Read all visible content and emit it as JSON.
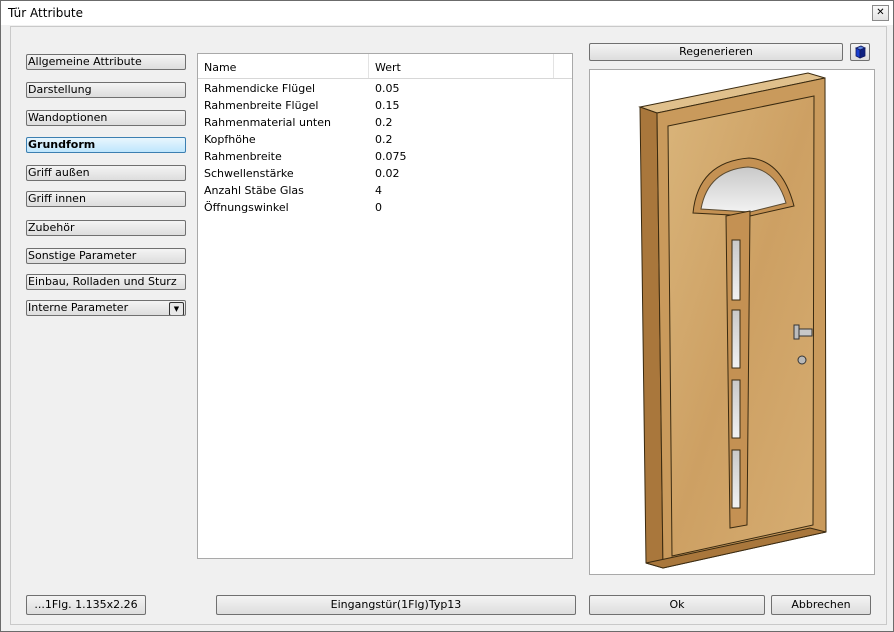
{
  "window": {
    "title": "Tür Attribute",
    "close_label": "✕"
  },
  "sidebar": {
    "items": [
      {
        "label": "Allgemeine Attribute"
      },
      {
        "label": "Darstellung"
      },
      {
        "label": "Wandoptionen"
      },
      {
        "label": "Grundform",
        "active": true
      },
      {
        "label": "Griff außen"
      },
      {
        "label": "Griff innen"
      },
      {
        "label": "Zubehör"
      },
      {
        "label": "Sonstige Parameter"
      },
      {
        "label": "Einbau, Rolladen und Sturz"
      },
      {
        "label": "Interne Parameter",
        "dropdown": true
      }
    ]
  },
  "table": {
    "columns": [
      "Name",
      "Wert"
    ],
    "rows": [
      {
        "name": "Rahmendicke Flügel",
        "value": "0.05"
      },
      {
        "name": "Rahmenbreite Flügel",
        "value": "0.15"
      },
      {
        "name": "Rahmenmaterial unten",
        "value": "0.2"
      },
      {
        "name": "Kopfhöhe",
        "value": "0.2"
      },
      {
        "name": "Rahmenbreite",
        "value": "0.075"
      },
      {
        "name": "Schwellenstärke",
        "value": "0.02"
      },
      {
        "name": "Anzahl Stäbe Glas",
        "value": "4"
      },
      {
        "name": "Öffnungswinkel",
        "value": "0"
      }
    ]
  },
  "preview": {
    "regenerate_label": "Regenerieren",
    "cube_icon": "cube-icon",
    "door_color": "#d4a86b"
  },
  "footer": {
    "size_label": "...1Flg. 1.135x2.26",
    "type_label": "Eingangstür(1Flg)Typ13",
    "ok_label": "Ok",
    "cancel_label": "Abbrechen"
  }
}
